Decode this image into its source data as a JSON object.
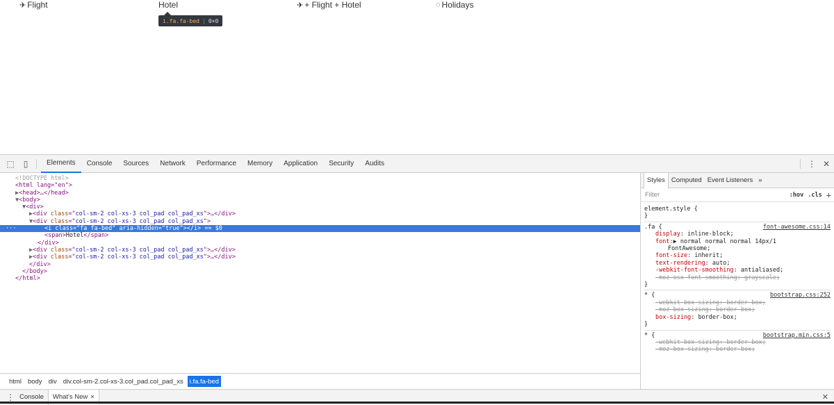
{
  "page": {
    "nav": [
      {
        "icon": "✈",
        "label": "Flight"
      },
      {
        "icon": "",
        "label": "Hotel"
      },
      {
        "icon": "✈",
        "label": " + Flight + Hotel"
      },
      {
        "icon": "◌",
        "label": "Holidays"
      }
    ],
    "tooltip": {
      "selector": "i.fa.fa-bed",
      "size": "0×0"
    }
  },
  "devtools": {
    "tabs": [
      "Elements",
      "Console",
      "Sources",
      "Network",
      "Performance",
      "Memory",
      "Application",
      "Security",
      "Audits"
    ],
    "active_tab": "Elements",
    "dom": {
      "doctype": "<!DOCTYPE html>",
      "html_open": "<html lang=\"en\">",
      "head": "<head>…</head>",
      "body_open": "<body>",
      "div_open": "<div>",
      "div_class_attr": "class",
      "div_class_value": "col-sm-2 col-xs-3 col_pad col_pad_xs",
      "collapsed_tail": ">…</div>",
      "i_line": "<i class=\"fa fa-bed\" aria-hidden=\"true\"></i> == $0",
      "span_open": "<span>",
      "span_text": "Hotel",
      "span_close": "</span>",
      "div_close": "</div>",
      "body_close": "</body>",
      "html_close": "</html>"
    },
    "breadcrumbs": [
      "html",
      "body",
      "div",
      "div.col-sm-2.col-xs-3.col_pad.col_pad_xs",
      "i.fa.fa-bed"
    ],
    "styles": {
      "tabs": [
        "Styles",
        "Computed",
        "Event Listeners",
        "»"
      ],
      "filter_placeholder": "Filter",
      "hov": ":hov",
      "cls": ".cls",
      "element_style": "element.style {",
      "close_brace": "}",
      "rules": [
        {
          "selector": ".fa {",
          "source": "font-awesome.css:14",
          "decls": [
            {
              "prop": "display",
              "value": "inline-block;",
              "strike": false
            },
            {
              "prop": "font",
              "value": "▶ normal normal normal 14px/1",
              "strike": false
            },
            {
              "prop": "",
              "value": "FontAwesome;",
              "strike": false,
              "wrap": true
            },
            {
              "prop": "font-size",
              "value": "inherit;",
              "strike": false
            },
            {
              "prop": "text-rendering",
              "value": "auto;",
              "strike": false
            },
            {
              "prop": "-webkit-font-smoothing",
              "value": "antialiased;",
              "strike": false
            },
            {
              "prop": "-moz-osx-font-smoothing",
              "value": "grayscale;",
              "strike": true
            }
          ]
        },
        {
          "selector": "* {",
          "source": "bootstrap.css:252",
          "decls": [
            {
              "prop": "-webkit-box-sizing",
              "value": "border-box;",
              "strike": true
            },
            {
              "prop": "-moz-box-sizing",
              "value": "border-box;",
              "strike": true
            },
            {
              "prop": "box-sizing",
              "value": "border-box;",
              "strike": false
            }
          ]
        },
        {
          "selector": "* {",
          "source": "bootstrap.min.css:5",
          "decls": [
            {
              "prop": "-webkit-box-sizing",
              "value": "border-box;",
              "strike": true
            },
            {
              "prop": "-moz-box-sizing",
              "value": "border-box;",
              "strike": true
            }
          ]
        }
      ]
    },
    "drawer": {
      "tabs": [
        "Console",
        "What's New"
      ],
      "close_glyph": "×"
    }
  },
  "colors": {
    "accent": "#1a73e8",
    "selection": "#3879d9",
    "tag": "#881280",
    "attr": "#994500",
    "value": "#1a1aa6"
  }
}
